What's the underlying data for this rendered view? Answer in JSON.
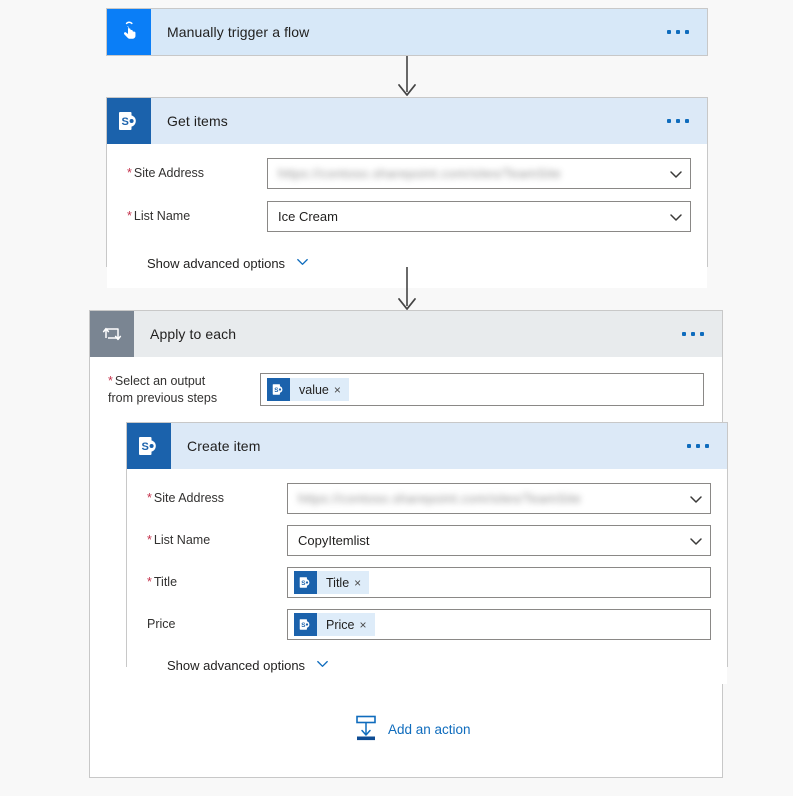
{
  "canvas": {
    "background": "#f8f8f8"
  },
  "colors": {
    "trigger_tile": "#0a7ef7",
    "sharepoint_tile": "#1b62ac",
    "loop_tile": "#7a8592",
    "card_header_blue": "#dce9f7",
    "loop_header_gray": "#e8ebed",
    "accent_link": "#0f6cbd",
    "required_asterisk": "#c4314b",
    "token_background": "#deecf9",
    "connector_arrow": "#444444",
    "card_border": "#c8c8c8",
    "input_border": "#8a8886"
  },
  "trigger_card": {
    "title": "Manually trigger a flow",
    "icon": "touch-tap-hand-icon",
    "menu": "ellipsis-menu"
  },
  "get_items_card": {
    "title": "Get items",
    "icon": "sharepoint-icon",
    "menu": "ellipsis-menu",
    "fields": [
      {
        "label": "Site Address",
        "required": true,
        "value": "https://contoso.sharepoint.com/sites/TeamSite",
        "redacted": true,
        "control": "dropdown"
      },
      {
        "label": "List Name",
        "required": true,
        "value": "Ice Cream",
        "redacted": false,
        "control": "dropdown"
      }
    ],
    "show_advanced_label": "Show advanced options"
  },
  "apply_to_each": {
    "title": "Apply to each",
    "icon": "loop-icon",
    "menu": "ellipsis-menu",
    "output_field": {
      "label_line1": "Select an output",
      "label_line2": "from previous steps",
      "required": true,
      "token": {
        "label": "value",
        "icon": "sharepoint-icon",
        "remove": "×"
      }
    }
  },
  "create_item_card": {
    "title": "Create item",
    "icon": "sharepoint-icon",
    "menu": "ellipsis-menu",
    "fields": [
      {
        "label": "Site Address",
        "required": true,
        "value": "https://contoso.sharepoint.com/sites/TeamSite",
        "redacted": true,
        "control": "dropdown"
      },
      {
        "label": "List Name",
        "required": true,
        "value": "CopyItemlist",
        "redacted": false,
        "control": "dropdown"
      },
      {
        "label": "Title",
        "required": true,
        "control": "token",
        "token": {
          "label": "Title",
          "icon": "sharepoint-icon",
          "remove": "×"
        }
      },
      {
        "label": "Price",
        "required": false,
        "control": "token",
        "token": {
          "label": "Price",
          "icon": "sharepoint-icon",
          "remove": "×"
        }
      }
    ],
    "show_advanced_label": "Show advanced options"
  },
  "add_action": {
    "label": "Add an action",
    "icon": "insert-step-icon"
  }
}
